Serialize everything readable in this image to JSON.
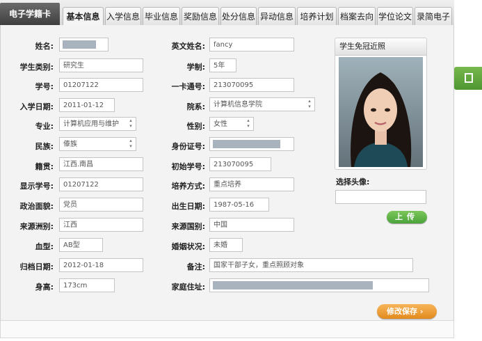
{
  "card_title": "电子学籍卡",
  "tabs": [
    "基本信息",
    "入学信息",
    "毕业信息",
    "奖励信息",
    "处分信息",
    "异动信息",
    "培养计划",
    "档案去向",
    "学位论文",
    "录简电子"
  ],
  "fields": {
    "name": {
      "label": "姓名:",
      "value": ""
    },
    "english_name": {
      "label": "英文姓名:",
      "value": "fancy"
    },
    "student_type": {
      "label": "学生类别:",
      "value": "研究生"
    },
    "schooling_length": {
      "label": "学制:",
      "value": "5年"
    },
    "student_id": {
      "label": "学号:",
      "value": "01207122"
    },
    "card_number": {
      "label": "一卡通号:",
      "value": "213070095"
    },
    "enroll_date": {
      "label": "入学日期:",
      "value": "2011-01-12"
    },
    "department": {
      "label": "院系:",
      "value": "计算机信息学院"
    },
    "major": {
      "label": "专业:",
      "value": "计算机应用与维护"
    },
    "gender": {
      "label": "性别:",
      "value": "女性"
    },
    "ethnicity": {
      "label": "民族:",
      "value": "傣族"
    },
    "id_number": {
      "label": "身份证号:",
      "value": ""
    },
    "native_place": {
      "label": "籍贯:",
      "value": "江西.南昌"
    },
    "initial_student_id": {
      "label": "初始学号:",
      "value": "213070095"
    },
    "display_student_id": {
      "label": "显示学号:",
      "value": "01207122"
    },
    "training_mode": {
      "label": "培养方式:",
      "value": "重点培养"
    },
    "political_status": {
      "label": "政治面貌:",
      "value": "党员"
    },
    "birth_date": {
      "label": "出生日期:",
      "value": "1987-05-16"
    },
    "source_province": {
      "label": "来源洲别:",
      "value": "江西"
    },
    "source_country": {
      "label": "来源国别:",
      "value": "中国"
    },
    "blood_type": {
      "label": "血型:",
      "value": "AB型"
    },
    "marital_status": {
      "label": "婚姻状况:",
      "value": "未婚"
    },
    "archive_date": {
      "label": "归档日期:",
      "value": "2012-01-18"
    },
    "remark": {
      "label": "备注:",
      "value": "国家干部子女，重点照顾对象"
    },
    "height": {
      "label": "身高:",
      "value": "173cm"
    },
    "home_address": {
      "label": "家庭住址:",
      "value": ""
    }
  },
  "photo": {
    "title": "学生免冠近照"
  },
  "avatar": {
    "label": "选择头像:",
    "file_value": ""
  },
  "buttons": {
    "upload": "上传",
    "save": "修改保存  ›"
  },
  "colors": {
    "mask": "#a9b3bd",
    "upload": "#5aad41",
    "save": "#eb9a31",
    "side_tab": "#5f9f3a"
  }
}
